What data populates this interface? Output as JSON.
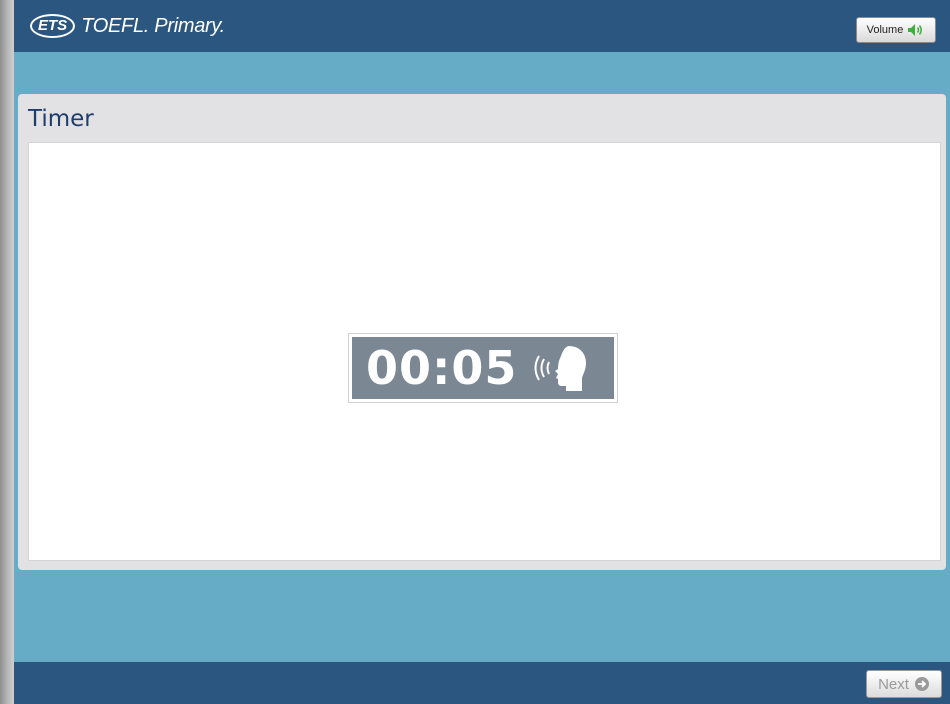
{
  "header": {
    "logo_brand": "ETS",
    "logo_product": "TOEFL. Primary.",
    "volume_label": "Volume",
    "volume_icon": "speaker-icon"
  },
  "panel": {
    "title": "Timer"
  },
  "timer": {
    "value": "00:05",
    "icon": "speaking-head-icon"
  },
  "footer": {
    "next_label": "Next",
    "next_icon": "arrow-right-circle-icon"
  },
  "colors": {
    "header_bg": "#2b5680",
    "band_bg": "#67acc6",
    "panel_bg": "#e2e2e4",
    "timer_bg": "#7b8793",
    "title_text": "#1f3d6b",
    "volume_icon": "#3fae3f"
  }
}
